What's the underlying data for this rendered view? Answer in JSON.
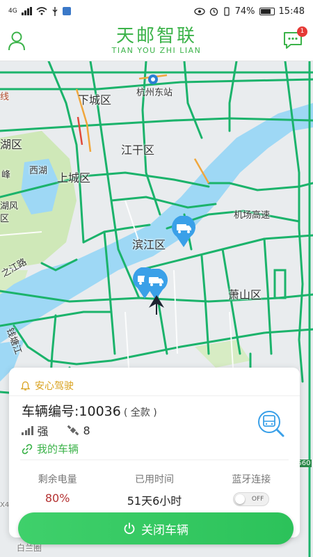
{
  "status_bar": {
    "network": "4G",
    "battery": "74%",
    "time": "15:48"
  },
  "header": {
    "logo_cn": "天邮智联",
    "logo_en": "TIAN YOU ZHI LIAN",
    "message_badge": "1"
  },
  "map": {
    "labels": {
      "xiacheng": "下城区",
      "hangzhou_east": "杭州东站",
      "jianggan": "江干区",
      "shangcheng": "上城区",
      "xihu": "西湖",
      "xihu_district": "湖区",
      "binjiang": "滨江区",
      "airport_highway": "机场高速",
      "xiaoshan": "萧山区",
      "jiang_road": "之江路",
      "qiantang_river": "钱塘江",
      "baiyun": "白兰圈",
      "g60": "G60",
      "hufeng": "湖风\n区",
      "feng": "峰",
      "xian": "线",
      "x4": "X4"
    },
    "truck_markers": 3
  },
  "card": {
    "safe_drive": "安心驾驶",
    "vehicle_number": "车辆编号:10036",
    "vehicle_model": "( 全款 )",
    "signal_strength": "强",
    "satellites": "8",
    "my_vehicles": "我的车辆",
    "stats": [
      {
        "label": "剩余电量",
        "value": "80%"
      },
      {
        "label": "已用时间",
        "value": "51天6小时"
      },
      {
        "label": "蓝牙连接",
        "toggle": "OFF"
      }
    ]
  },
  "bottom_button": {
    "label": "关闭车辆"
  },
  "colors": {
    "brand_green": "#3cb34a",
    "road_green": "#1bb36b",
    "river": "#9ed8f5",
    "park": "#cfe8b8",
    "warning_gold": "#d9a11d",
    "battery_red": "#b43232",
    "pin_blue": "#3aa0e8"
  }
}
